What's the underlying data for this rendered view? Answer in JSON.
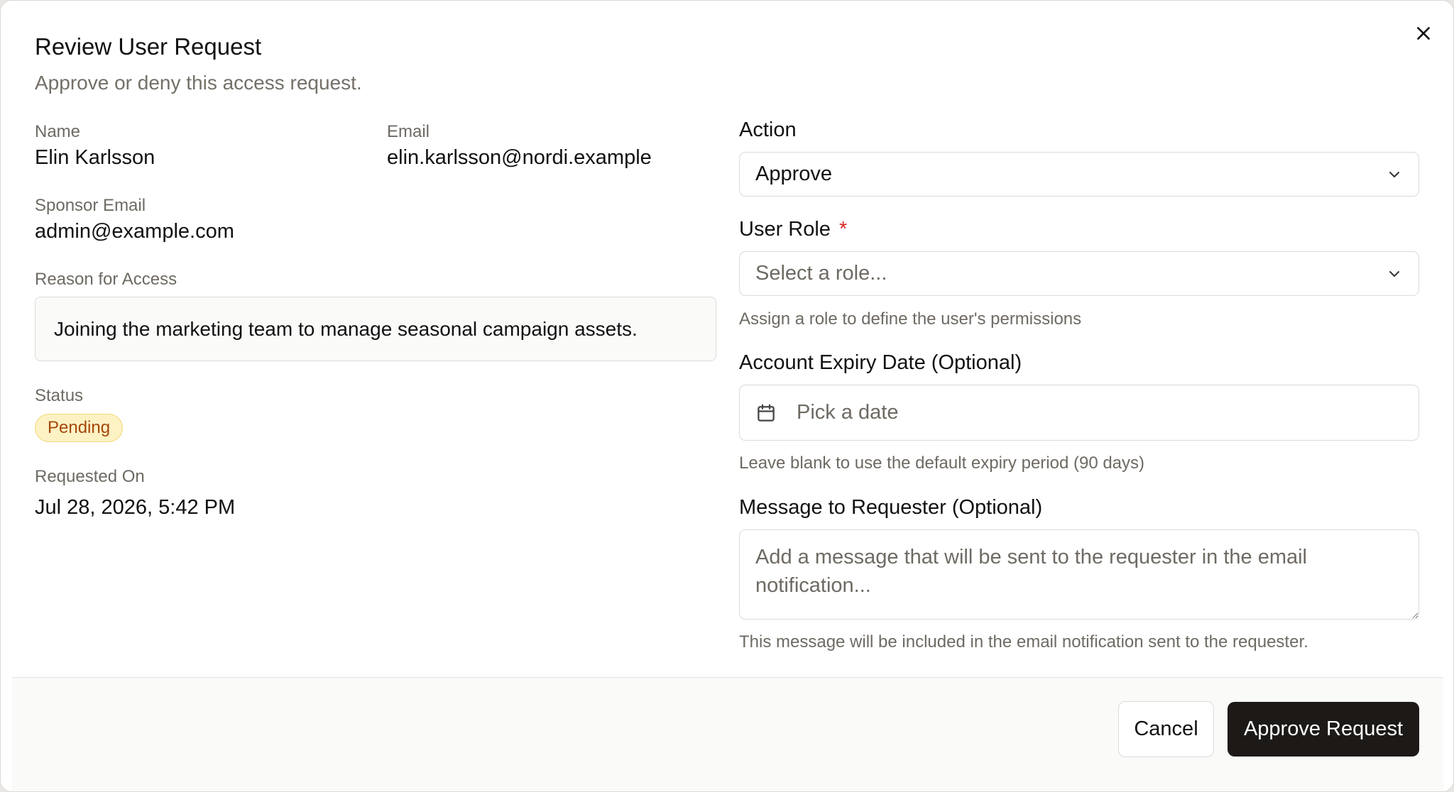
{
  "dialog": {
    "title": "Review User Request",
    "subtitle": "Approve or deny this access request."
  },
  "details": {
    "name_label": "Name",
    "name_value": "Elin Karlsson",
    "email_label": "Email",
    "email_value": "elin.karlsson@nordi.example",
    "sponsor_label": "Sponsor Email",
    "sponsor_value": "admin@example.com",
    "reason_label": "Reason for Access",
    "reason_value": "Joining the marketing team to manage seasonal campaign assets.",
    "status_label": "Status",
    "status_value": "Pending",
    "requested_label": "Requested On",
    "requested_value": "Jul 28, 2026, 5:42 PM"
  },
  "form": {
    "action_label": "Action",
    "action_value": "Approve",
    "role_label": "User Role",
    "role_required_mark": "*",
    "role_placeholder": "Select a role...",
    "role_hint": "Assign a role to define the user's permissions",
    "expiry_label": "Account Expiry Date (Optional)",
    "expiry_placeholder": "Pick a date",
    "expiry_hint": "Leave blank to use the default expiry period (90 days)",
    "message_label": "Message to Requester (Optional)",
    "message_placeholder": "Add a message that will be sent to the requester in the email notification...",
    "message_hint": "This message will be included in the email notification sent to the requester."
  },
  "footer": {
    "cancel_label": "Cancel",
    "approve_label": "Approve Request"
  },
  "icons": {
    "close": "close-icon",
    "chevron": "chevron-down-icon",
    "calendar": "calendar-icon"
  },
  "colors": {
    "primary_button": "#1c1917",
    "badge_bg": "#fdf2c4",
    "badge_text": "#a5470c",
    "required": "#dc2626"
  }
}
